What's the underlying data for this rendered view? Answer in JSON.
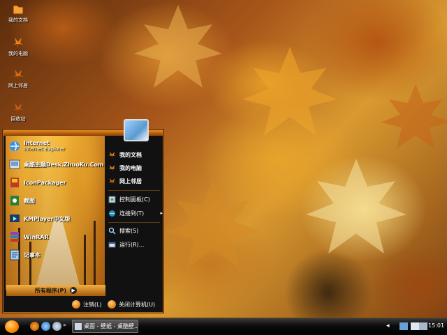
{
  "desktop": {
    "icons": [
      {
        "label": "我的文档",
        "icon": "my-documents-icon"
      },
      {
        "label": "我的电脑",
        "icon": "my-computer-icon"
      },
      {
        "label": "网上邻居",
        "icon": "network-places-icon"
      },
      {
        "label": "回收站",
        "icon": "recycle-bin-icon"
      }
    ]
  },
  "start_menu": {
    "pinned": [
      {
        "title": "Internet",
        "subtitle": "Internet Explorer",
        "icon": "internet-explorer-icon"
      },
      {
        "title": "桌酷主题Desk.ZhuoKu.Com",
        "icon": "zhuoku-theme-icon"
      },
      {
        "title": "IconPackager",
        "icon": "iconpackager-icon"
      },
      {
        "title": "截图",
        "icon": "screenshot-icon"
      },
      {
        "title": "KMPlayer中文版",
        "icon": "kmplayer-icon"
      },
      {
        "title": "WinRAR",
        "icon": "winrar-icon"
      },
      {
        "title": "记事本",
        "icon": "notepad-icon"
      }
    ],
    "all_programs": "所有程序(P)",
    "right": [
      {
        "label": "我的文档",
        "icon": "my-documents-icon"
      },
      {
        "label": "我的电脑",
        "icon": "my-computer-icon"
      },
      {
        "label": "网上邻居",
        "icon": "network-places-icon"
      },
      {
        "label": "控制面板(C)",
        "icon": "control-panel-icon"
      },
      {
        "label": "连接到(T)",
        "icon": "connect-to-icon",
        "arrow": "▸"
      },
      {
        "label": "搜索(S)",
        "icon": "search-icon"
      },
      {
        "label": "运行(R)...",
        "icon": "run-icon"
      }
    ],
    "logoff": "注销(L)",
    "shutdown": "关闭计算机(U)"
  },
  "taskbar": {
    "task_label": "桌面 - 壁纸 - 桌酷壁...",
    "tray_arrow": "◂",
    "clock": "15:01"
  }
}
